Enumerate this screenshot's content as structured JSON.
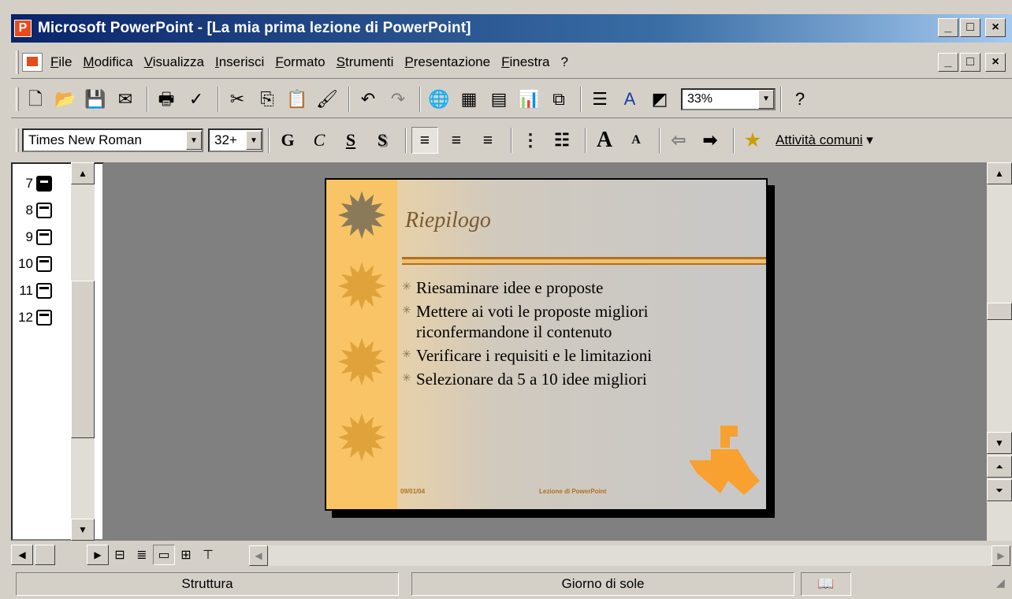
{
  "window": {
    "app_icon_glyph": "P",
    "title": "Microsoft PowerPoint - [La mia prima lezione di PowerPoint]",
    "controls": {
      "minimize": "_",
      "maximize": "□",
      "close": "×"
    }
  },
  "menubar": {
    "items": [
      "File",
      "Modifica",
      "Visualizza",
      "Inserisci",
      "Formato",
      "Strumenti",
      "Presentazione",
      "Finestra",
      "?"
    ]
  },
  "toolbar_standard": {
    "zoom": "33%",
    "buttons": [
      "new-icon",
      "open-icon",
      "save-icon",
      "email-icon",
      "print-icon",
      "spelling-icon",
      "cut-icon",
      "copy-icon",
      "paste-icon",
      "format-painter-icon",
      "undo-icon",
      "redo-icon",
      "hyperlink-icon",
      "tables-borders-icon",
      "insert-table-icon",
      "insert-chart-icon",
      "new-slide-icon",
      "expand-all-icon",
      "show-formatting-icon",
      "grayscale-icon",
      "help-icon"
    ]
  },
  "toolbar_formatting": {
    "font": "Times New Roman",
    "size": "32+",
    "bold": "G",
    "italic": "C",
    "underline": "S",
    "shadow": "S",
    "tasks_label": "Attività comuni"
  },
  "outline": {
    "slides": [
      {
        "num": "7",
        "active": true
      },
      {
        "num": "8",
        "active": false
      },
      {
        "num": "9",
        "active": false
      },
      {
        "num": "10",
        "active": false
      },
      {
        "num": "11",
        "active": false
      },
      {
        "num": "12",
        "active": false
      }
    ]
  },
  "slide": {
    "title": "Riepilogo",
    "bullets": [
      "Riesaminare idee e proposte",
      "Mettere ai voti le proposte migliori riconfermandone il contenuto",
      "Verificare i requisiti e le limitazioni",
      "Selezionare da 5 a 10 idee migliori"
    ],
    "footer_left": "09/01/04",
    "footer_center": "Lezione di PowerPoint",
    "colors": {
      "accent": "#b07020",
      "sidebar": "#f8c466",
      "logo": "#f8a030"
    }
  },
  "statusbar": {
    "view": "Struttura",
    "design": "Giorno di sole"
  }
}
